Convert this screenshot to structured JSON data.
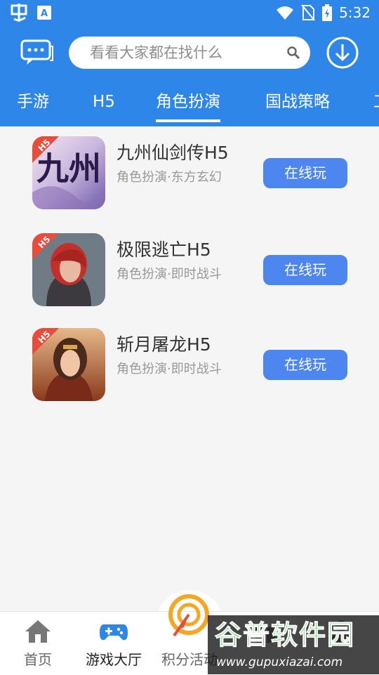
{
  "status_bar": {
    "time": "5:32"
  },
  "header": {
    "search_placeholder": "看看大家都在找什么"
  },
  "tabs": [
    {
      "label": "手游"
    },
    {
      "label": "H5"
    },
    {
      "label": "角色扮演"
    },
    {
      "label": "国战策略"
    },
    {
      "label": "工"
    }
  ],
  "games": [
    {
      "title": "九州仙剑传H5",
      "subtitle": "角色扮演·东方玄幻",
      "button": "在线玩",
      "icon_text": "九州",
      "badge": "H5"
    },
    {
      "title": "极限逃亡H5",
      "subtitle": "角色扮演·即时战斗",
      "button": "在线玩",
      "badge": "H5"
    },
    {
      "title": "斩月屠龙H5",
      "subtitle": "角色扮演·即时战斗",
      "button": "在线玩",
      "badge": "H5"
    }
  ],
  "bottom_nav": [
    {
      "label": "首页"
    },
    {
      "label": "游戏大厅"
    },
    {
      "label": "积分活动"
    },
    {
      "label": ""
    },
    {
      "label": ""
    }
  ],
  "watermark": {
    "logo": "谷普软件园",
    "url": "www.gupuxiazai.com"
  },
  "colors": {
    "primary": "#2d86e8",
    "button": "#4d86ee",
    "accent_orange": "#f5a623",
    "accent_red": "#e94b3c"
  }
}
